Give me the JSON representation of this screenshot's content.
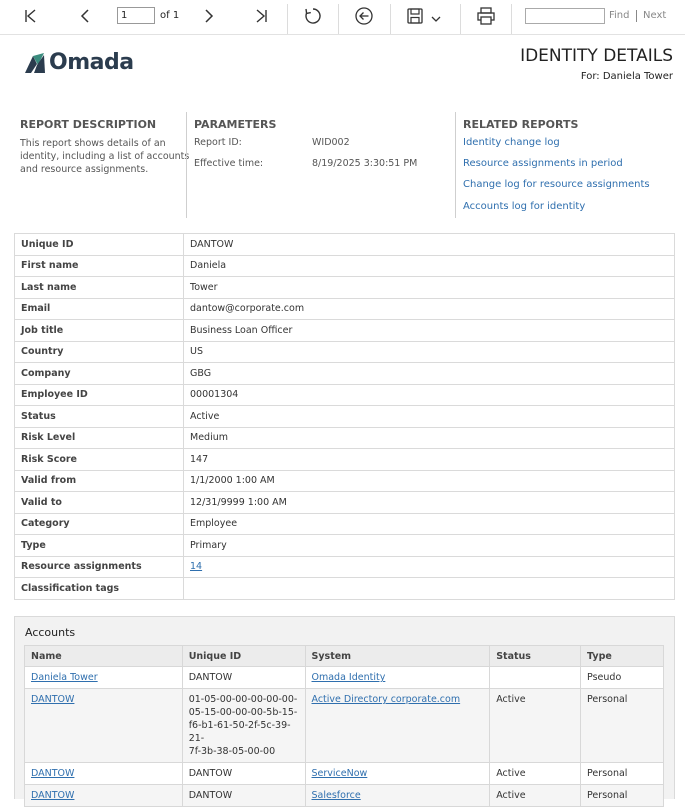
{
  "toolbar": {
    "page_value": "1",
    "page_of": "of 1",
    "find_label": "Find",
    "next_label": "Next"
  },
  "header": {
    "logo_text": "Omada",
    "title": "IDENTITY DETAILS",
    "for_line": "For: Daniela Tower"
  },
  "description": {
    "title": "REPORT DESCRIPTION",
    "lines": [
      "This report shows details of an",
      "identity, including a list of accounts",
      "and resource assignments."
    ]
  },
  "parameters": {
    "title": "PARAMETERS",
    "items": [
      {
        "label": "Report ID:",
        "value": "WID002"
      },
      {
        "label": "Effective time:",
        "value": "8/19/2025 3:30:51 PM"
      }
    ]
  },
  "related": {
    "title": "RELATED REPORTS",
    "links": [
      "Identity change log",
      "Resource assignments in period",
      "Change log for resource assignments",
      "Accounts log for identity"
    ]
  },
  "details": [
    {
      "key": "Unique ID",
      "value": "DANTOW"
    },
    {
      "key": "First name",
      "value": "Daniela"
    },
    {
      "key": "Last name",
      "value": "Tower"
    },
    {
      "key": "Email",
      "value": "dantow@corporate.com"
    },
    {
      "key": "Job title",
      "value": "Business Loan Officer"
    },
    {
      "key": "Country",
      "value": "US"
    },
    {
      "key": "Company",
      "value": "GBG"
    },
    {
      "key": "Employee ID",
      "value": "00001304"
    },
    {
      "key": "Status",
      "value": "Active"
    },
    {
      "key": "Risk Level",
      "value": "Medium"
    },
    {
      "key": "Risk Score",
      "value": "147"
    },
    {
      "key": "Valid from",
      "value": "1/1/2000 1:00 AM"
    },
    {
      "key": "Valid to",
      "value": "12/31/9999 1:00 AM"
    },
    {
      "key": "Category",
      "value": "Employee"
    },
    {
      "key": "Type",
      "value": "Primary"
    },
    {
      "key": "Resource assignments",
      "value": "14"
    },
    {
      "key": "Classification tags",
      "value": ""
    }
  ],
  "accounts": {
    "title": "Accounts",
    "headers": [
      "Name",
      "Unique ID",
      "System",
      "Status",
      "Type"
    ],
    "rows": [
      {
        "name": "Daniela Tower",
        "uid": [
          "DANTOW"
        ],
        "system": "Omada Identity",
        "status": "",
        "type": "Pseudo"
      },
      {
        "name": "DANTOW",
        "uid": [
          "01-05-00-00-00-00-00-",
          "05-15-00-00-00-5b-15-",
          "f6-b1-61-50-2f-5c-39-21-",
          "7f-3b-38-05-00-00"
        ],
        "system": "Active Directory corporate.com",
        "status": "Active",
        "type": "Personal"
      },
      {
        "name": "DANTOW",
        "uid": [
          "DANTOW"
        ],
        "system": "ServiceNow",
        "status": "Active",
        "type": "Personal"
      },
      {
        "name": "DANTOW",
        "uid": [
          "DANTOW"
        ],
        "system": "Salesforce",
        "status": "Active",
        "type": "Personal"
      }
    ]
  }
}
